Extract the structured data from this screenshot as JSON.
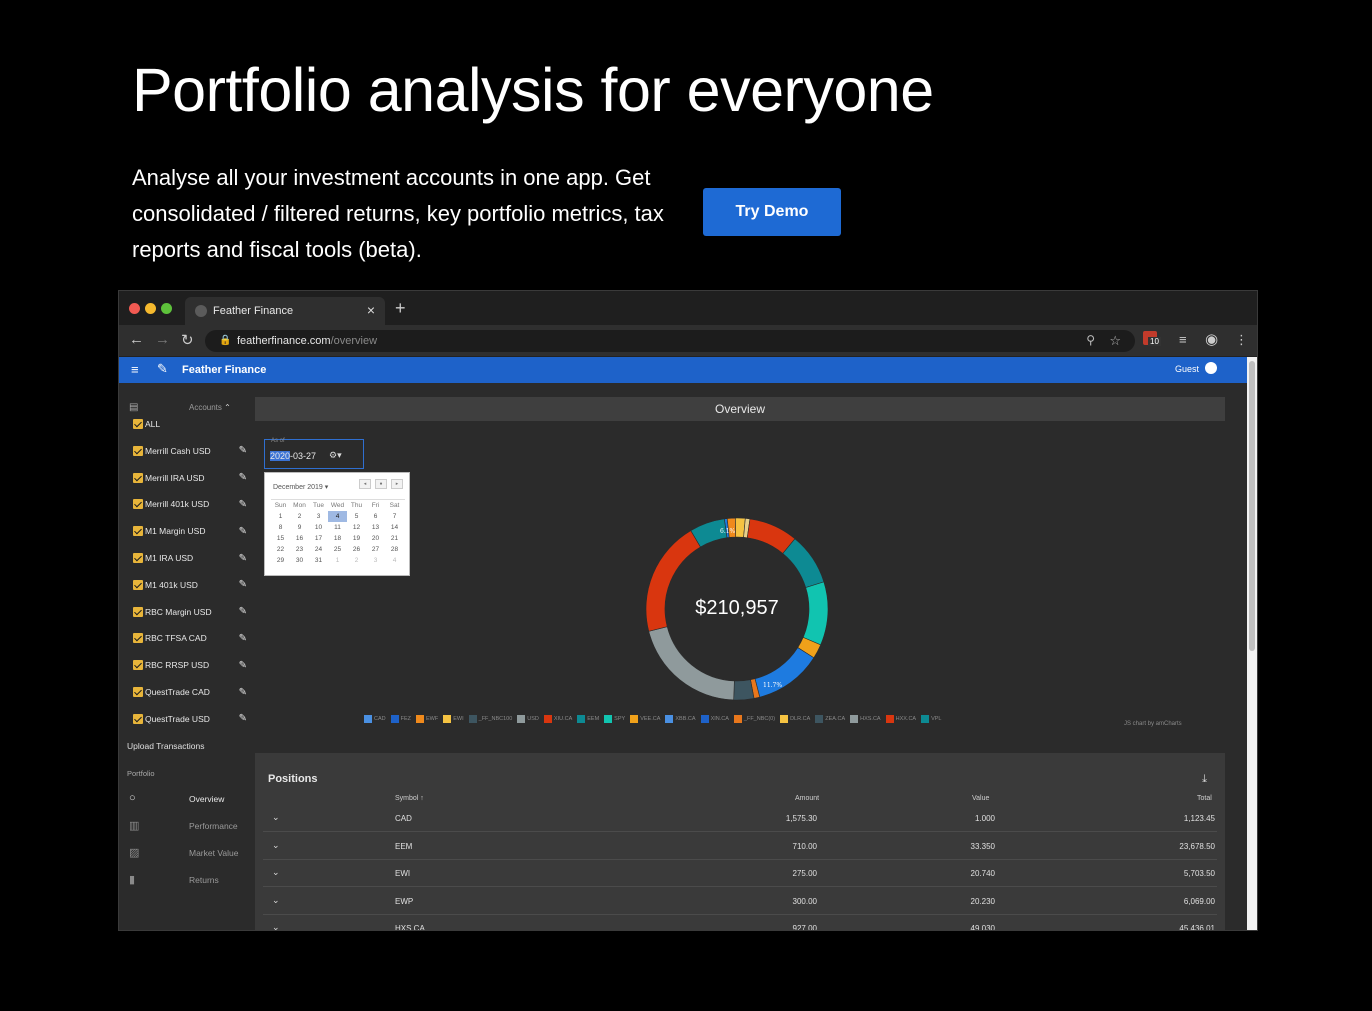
{
  "hero": {
    "title": "Portfolio analysis for everyone",
    "subtitle": "Analyse all your investment accounts in one app. Get consolidated / filtered returns, key portfolio metrics, tax reports and fiscal tools (beta).",
    "cta": "Try Demo"
  },
  "browser": {
    "tab_title": "Feather Finance",
    "url_domain": "featherfinance.com",
    "url_path": "/overview",
    "extension_badge": "10"
  },
  "app": {
    "name": "Feather Finance",
    "user": "Guest",
    "accent_color": "#1e62c9"
  },
  "sidebar": {
    "accounts_header": "Accounts",
    "accounts": [
      {
        "label": "ALL",
        "checked": true
      },
      {
        "label": "Merrill Cash USD",
        "checked": true
      },
      {
        "label": "Merrill IRA USD",
        "checked": true
      },
      {
        "label": "Merrill 401k USD",
        "checked": true
      },
      {
        "label": "M1 Margin USD",
        "checked": true
      },
      {
        "label": "M1 IRA USD",
        "checked": true
      },
      {
        "label": "M1 401k USD",
        "checked": true
      },
      {
        "label": "RBC Margin USD",
        "checked": true
      },
      {
        "label": "RBC TFSA CAD",
        "checked": true
      },
      {
        "label": "RBC RRSP USD",
        "checked": true
      },
      {
        "label": "QuestTrade CAD",
        "checked": true
      },
      {
        "label": "QuestTrade USD",
        "checked": true
      }
    ],
    "upload": "Upload Transactions",
    "portfolio_label": "Portfolio",
    "portfolio_items": [
      "Overview",
      "Performance",
      "Market Value",
      "Returns"
    ]
  },
  "overview": {
    "title": "Overview",
    "as_of_label": "As of",
    "date_selected_part": "2020",
    "date_rest": "-03-27"
  },
  "calendar": {
    "month": "December 2019",
    "weekdays": [
      "Sun",
      "Mon",
      "Tue",
      "Wed",
      "Thu",
      "Fri",
      "Sat"
    ],
    "weeks": [
      [
        "1",
        "2",
        "3",
        "4",
        "5",
        "6",
        "7"
      ],
      [
        "8",
        "9",
        "10",
        "11",
        "12",
        "13",
        "14"
      ],
      [
        "15",
        "16",
        "17",
        "18",
        "19",
        "20",
        "21"
      ],
      [
        "22",
        "23",
        "24",
        "25",
        "26",
        "27",
        "28"
      ],
      [
        "29",
        "30",
        "31",
        "1",
        "2",
        "3",
        "4"
      ]
    ],
    "today": "4"
  },
  "chart_data": {
    "type": "pie",
    "total_label": "$210,957",
    "slice_labels_shown": [
      "6.1%",
      "11.7%"
    ],
    "series": [
      {
        "name": "CAD",
        "value": 0.5,
        "color": "#1e7be0"
      },
      {
        "name": "FEZ",
        "value": 1.4,
        "color": "#f08a1c"
      },
      {
        "name": "EWF",
        "value": 1.7,
        "color": "#f5c342"
      },
      {
        "name": "EWI",
        "value": 0.8,
        "color": "#e8d08a"
      },
      {
        "name": "_FF_NBC100",
        "value": 8.5,
        "color": "#d9360f"
      },
      {
        "name": "USD",
        "value": 9.0,
        "color": "#0d8a93"
      },
      {
        "name": "XIU.CA",
        "value": 11.0,
        "color": "#11c4b0"
      },
      {
        "name": "EEM",
        "value": 2.5,
        "color": "#f0a11a"
      },
      {
        "name": "SPY",
        "value": 11.7,
        "color": "#1e7be0"
      },
      {
        "name": "VEE.CA",
        "value": 1.0,
        "color": "#e8771c"
      },
      {
        "name": "XBB.CA",
        "value": 3.5,
        "color": "#3d5560"
      },
      {
        "name": "XIN.CA",
        "value": 20.0,
        "color": "#8f9a9c"
      },
      {
        "name": "_FF_NBC(0)",
        "value": 20.0,
        "color": "#d9360f"
      },
      {
        "name": "VPL",
        "value": 6.1,
        "color": "#0d8a93"
      }
    ],
    "legend": [
      {
        "name": "CAD",
        "color": "#4a90e2"
      },
      {
        "name": "FEZ",
        "color": "#1e62c9"
      },
      {
        "name": "EWF",
        "color": "#f08a1c"
      },
      {
        "name": "EWI",
        "color": "#f5c342"
      },
      {
        "name": "_FF_NBC100",
        "color": "#3d5560"
      },
      {
        "name": "USD",
        "color": "#8f9a9c"
      },
      {
        "name": "XIU.CA",
        "color": "#d9360f"
      },
      {
        "name": "EEM",
        "color": "#0d8a93"
      },
      {
        "name": "SPY",
        "color": "#11c4b0"
      },
      {
        "name": "VEE.CA",
        "color": "#f0a11a"
      },
      {
        "name": "XBB.CA",
        "color": "#4a90e2"
      },
      {
        "name": "XIN.CA",
        "color": "#1e62c9"
      },
      {
        "name": "_FF_NBC(0)",
        "color": "#e8771c"
      },
      {
        "name": "DLR.CA",
        "color": "#f5c342"
      },
      {
        "name": "ZEA.CA",
        "color": "#3d5560"
      },
      {
        "name": "HXS.CA",
        "color": "#8f9a9c"
      },
      {
        "name": "HXX.CA",
        "color": "#d9360f"
      },
      {
        "name": "VPL",
        "color": "#0d8a93"
      }
    ],
    "credit": "JS chart by amCharts"
  },
  "positions": {
    "title": "Positions",
    "columns": [
      "Symbol",
      "Amount",
      "Value",
      "Total"
    ],
    "rows": [
      {
        "symbol": "CAD",
        "amount": "1,575.30",
        "value": "1.000",
        "total": "1,123.45"
      },
      {
        "symbol": "EEM",
        "amount": "710.00",
        "value": "33.350",
        "total": "23,678.50"
      },
      {
        "symbol": "EWI",
        "amount": "275.00",
        "value": "20.740",
        "total": "5,703.50"
      },
      {
        "symbol": "EWP",
        "amount": "300.00",
        "value": "20.230",
        "total": "6,069.00"
      },
      {
        "symbol": "HXS.CA",
        "amount": "927.00",
        "value": "49.030",
        "total": "45,436.01"
      }
    ]
  }
}
